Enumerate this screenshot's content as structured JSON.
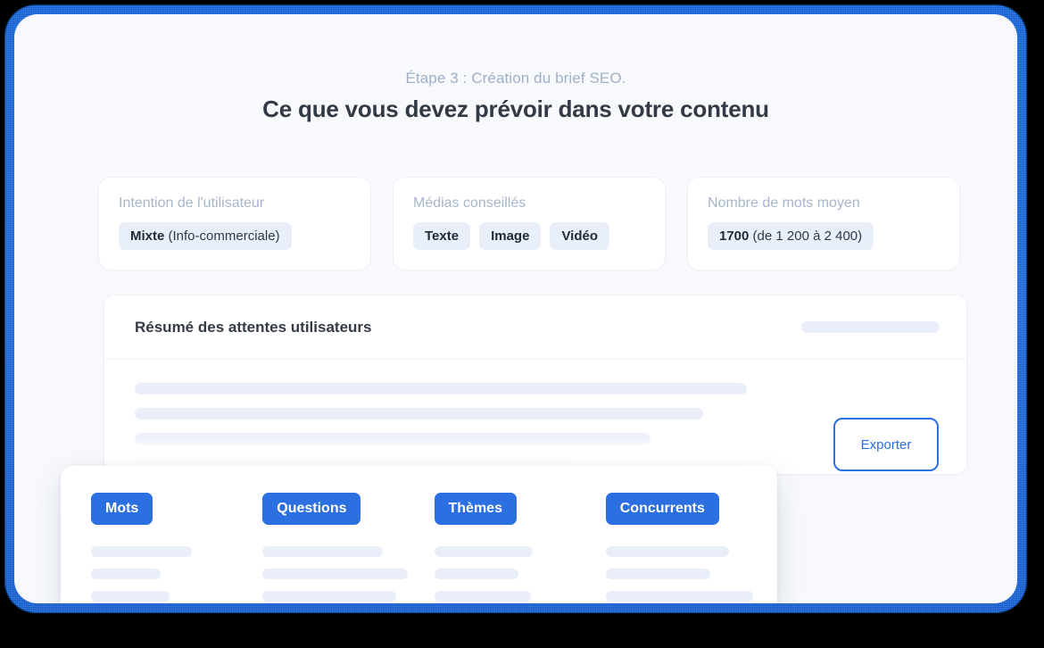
{
  "header": {
    "eyebrow": "Étape 3 : Création du brief SEO.",
    "title": "Ce que vous devez prévoir dans votre contenu"
  },
  "colors": {
    "frame_blue": "#2a6fe4",
    "accent": "#2b6fe0",
    "badge_bg": "#e9eff9",
    "skeleton": "#e9eef8",
    "page_bg": "#f7f9fc",
    "label_gray": "#a7b5cb",
    "title_dark": "#323a45"
  },
  "info_cards": [
    {
      "label": "Intention de l'utilisateur",
      "badges": [
        {
          "strong": "Mixte",
          "rest": " (Info-commerciale)"
        }
      ]
    },
    {
      "label": "Médias conseillés",
      "badges": [
        {
          "strong": "Texte",
          "rest": ""
        },
        {
          "strong": "Image",
          "rest": ""
        },
        {
          "strong": "Vidéo",
          "rest": ""
        }
      ]
    },
    {
      "label": "Nombre de mots moyen",
      "badges": [
        {
          "strong": "1700",
          "rest": " (de 1 200 à 2 400)"
        }
      ]
    }
  ],
  "panel": {
    "title": "Résumé des attentes utilisateurs",
    "header_skeleton_width": 155,
    "body_skeleton_widths": [
      686,
      637,
      578,
      492
    ]
  },
  "export_button": {
    "label": "Exporter"
  },
  "tabs_card": {
    "columns": [
      {
        "label": "Mots",
        "line_widths": [
          113,
          78,
          88
        ]
      },
      {
        "label": "Questions",
        "line_widths": [
          135,
          163,
          150
        ]
      },
      {
        "label": "Thèmes",
        "line_widths": [
          110,
          94,
          108
        ]
      },
      {
        "label": "Concurrents",
        "line_widths": [
          138,
          117,
          165
        ]
      }
    ]
  }
}
